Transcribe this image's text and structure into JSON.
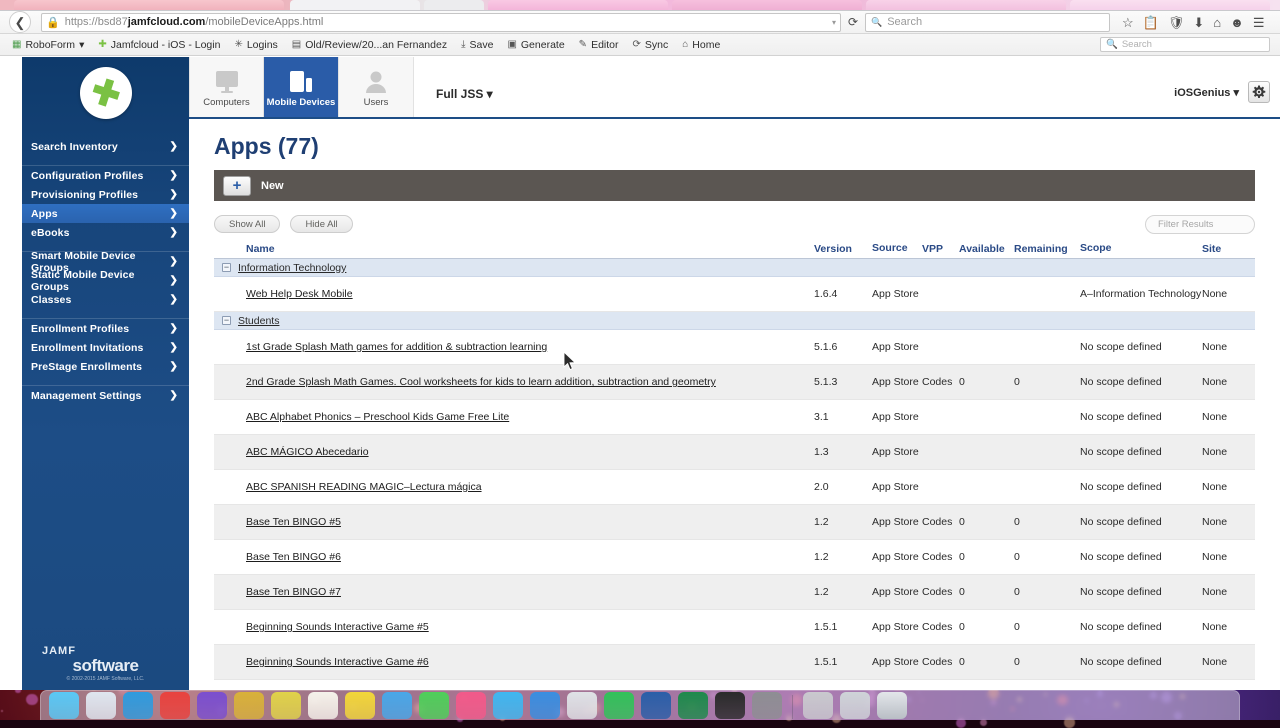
{
  "browser": {
    "back_icon": "back-arrow-icon",
    "lock_icon": "lock-icon",
    "url_scheme": "https://bsd87 ",
    "url_host": "jamfcloud.com",
    "url_path": "/mobileDeviceApps.html",
    "url_dropdown": "▾",
    "reload_icon": "reload-icon",
    "search_placeholder": "Search",
    "nav_icons": [
      "star-icon",
      "clipboard-icon",
      "shield-icon",
      "download-icon",
      "home-icon",
      "account-icon",
      "menu-icon"
    ],
    "bookmarks": [
      {
        "label": "RoboForm",
        "icon": "roboform-icon",
        "caret": "▾"
      },
      {
        "label": "Jamfcloud - iOS - Login",
        "icon": "jamf-icon",
        "caret": ""
      },
      {
        "label": "Logins",
        "icon": "logins-icon",
        "caret": ""
      },
      {
        "label": "Old/Review/20...an Fernandez",
        "icon": "folder-icon",
        "caret": ""
      },
      {
        "label": "Save",
        "icon": "save-icon",
        "caret": ""
      },
      {
        "label": "Generate",
        "icon": "generate-icon",
        "caret": ""
      },
      {
        "label": "Editor",
        "icon": "editor-icon",
        "caret": ""
      },
      {
        "label": "Sync",
        "icon": "sync-icon",
        "caret": ""
      },
      {
        "label": "Home",
        "icon": "home-icon",
        "caret": ""
      }
    ],
    "bookmark_search_placeholder": "Search"
  },
  "sidebar": {
    "logo_name": "jamf-cross-logo",
    "groups": [
      {
        "items": [
          {
            "label": "Search Inventory",
            "active": false
          }
        ]
      },
      {
        "items": [
          {
            "label": "Configuration Profiles",
            "active": false
          },
          {
            "label": "Provisioning Profiles",
            "active": false
          },
          {
            "label": "Apps",
            "active": true
          },
          {
            "label": "eBooks",
            "active": false
          }
        ]
      },
      {
        "items": [
          {
            "label": "Smart Mobile Device Groups",
            "active": false
          },
          {
            "label": "Static Mobile Device Groups",
            "active": false
          },
          {
            "label": "Classes",
            "active": false
          }
        ]
      },
      {
        "items": [
          {
            "label": "Enrollment Profiles",
            "active": false
          },
          {
            "label": "Enrollment Invitations",
            "active": false
          },
          {
            "label": "PreStage Enrollments",
            "active": false
          }
        ]
      },
      {
        "items": [
          {
            "label": "Management Settings",
            "active": false
          }
        ]
      }
    ],
    "chevron": "❯",
    "footer_brand_top": "JAMF",
    "footer_brand_bottom": "software",
    "footer_copyright": "© 2002-2015 JAMF Software, LLC."
  },
  "topbar": {
    "segments": [
      {
        "label": "Computers",
        "icon": "desktop-computer-icon",
        "active": false
      },
      {
        "label": "Mobile Devices",
        "icon": "mobile-devices-icon",
        "active": true
      },
      {
        "label": "Users",
        "icon": "user-person-icon",
        "active": false
      }
    ],
    "scope_select": "Full JSS ▾",
    "user_menu": "iOSGenius ▾",
    "gear_icon": "gear-icon"
  },
  "main": {
    "page_title": "Apps (77)",
    "new_button_label": "New",
    "new_button_plus": "+",
    "show_all_label": "Show All",
    "hide_all_label": "Hide All",
    "filter_placeholder": "Filter Results",
    "columns": [
      "Name",
      "Version",
      "Source",
      "VPP",
      "Available",
      "Remaining",
      "Scope",
      "Site"
    ],
    "rows": [
      {
        "type": "group",
        "name": "Information Technology",
        "toggle": "−"
      },
      {
        "type": "app",
        "name": "Web Help Desk Mobile",
        "version": "1.6.4",
        "source": "App Store",
        "vpp": "",
        "available": "",
        "remaining": "",
        "scope": "A–Information Technology",
        "site": "None",
        "alt": false
      },
      {
        "type": "group",
        "name": "Students",
        "toggle": "−"
      },
      {
        "type": "app",
        "name": "1st Grade Splash Math games for addition & subtraction learning",
        "version": "5.1.6",
        "source": "App Store",
        "vpp": "",
        "available": "",
        "remaining": "",
        "scope": "No scope defined",
        "site": "None",
        "alt": false
      },
      {
        "type": "app",
        "name": "2nd Grade Splash Math Games. Cool worksheets for kids to learn addition, subtraction and geometry",
        "version": "5.1.3",
        "source": "App Store",
        "vpp": "Codes",
        "available": "0",
        "remaining": "0",
        "scope": "No scope defined",
        "site": "None",
        "alt": true
      },
      {
        "type": "app",
        "name": "ABC Alphabet Phonics – Preschool Kids Game Free Lite",
        "version": "3.1",
        "source": "App Store",
        "vpp": "",
        "available": "",
        "remaining": "",
        "scope": "No scope defined",
        "site": "None",
        "alt": false
      },
      {
        "type": "app",
        "name": "ABC MÁGICO Abecedario",
        "version": "1.3",
        "source": "App Store",
        "vpp": "",
        "available": "",
        "remaining": "",
        "scope": "No scope defined",
        "site": "None",
        "alt": true
      },
      {
        "type": "app",
        "name": "ABC SPANISH READING MAGIC–Lectura mágica",
        "version": "2.0",
        "source": "App Store",
        "vpp": "",
        "available": "",
        "remaining": "",
        "scope": "No scope defined",
        "site": "None",
        "alt": false
      },
      {
        "type": "app",
        "name": "Base Ten BINGO #5",
        "version": "1.2",
        "source": "App Store",
        "vpp": "Codes",
        "available": "0",
        "remaining": "0",
        "scope": "No scope defined",
        "site": "None",
        "alt": true
      },
      {
        "type": "app",
        "name": "Base Ten BINGO #6",
        "version": "1.2",
        "source": "App Store",
        "vpp": "Codes",
        "available": "0",
        "remaining": "0",
        "scope": "No scope defined",
        "site": "None",
        "alt": false
      },
      {
        "type": "app",
        "name": "Base Ten BINGO #7",
        "version": "1.2",
        "source": "App Store",
        "vpp": "Codes",
        "available": "0",
        "remaining": "0",
        "scope": "No scope defined",
        "site": "None",
        "alt": true
      },
      {
        "type": "app",
        "name": "Beginning Sounds Interactive Game #5",
        "version": "1.5.1",
        "source": "App Store",
        "vpp": "Codes",
        "available": "0",
        "remaining": "0",
        "scope": "No scope defined",
        "site": "None",
        "alt": false
      },
      {
        "type": "app",
        "name": "Beginning Sounds Interactive Game #6",
        "version": "1.5.1",
        "source": "App Store",
        "vpp": "Codes",
        "available": "0",
        "remaining": "0",
        "scope": "No scope defined",
        "site": "None",
        "alt": true
      }
    ]
  },
  "colors": {
    "sidebar_blue": "#1d4d86",
    "accent_blue": "#2a5ca8",
    "title_blue": "#1f3f73",
    "action_bar": "#5b5652",
    "group_row": "#dde6f2",
    "alt_row": "#efefef",
    "jamf_green": "#7ac143"
  },
  "dock": {
    "icons": [
      "finder-icon",
      "launchpad-icon",
      "safari-icon",
      "mail-icon",
      "contacts-icon",
      "calendar-icon",
      "notes-icon",
      "pages-icon",
      "numbers-icon",
      "firefox-icon",
      "messages-icon",
      "photos-icon",
      "itunes-icon",
      "appstore-icon",
      "preview-icon",
      "facetime-icon",
      "word-icon",
      "excel-icon",
      "terminal-icon",
      "systemprefs-icon",
      "downloads-stack-icon",
      "documents-stack-icon",
      "trash-icon"
    ]
  }
}
